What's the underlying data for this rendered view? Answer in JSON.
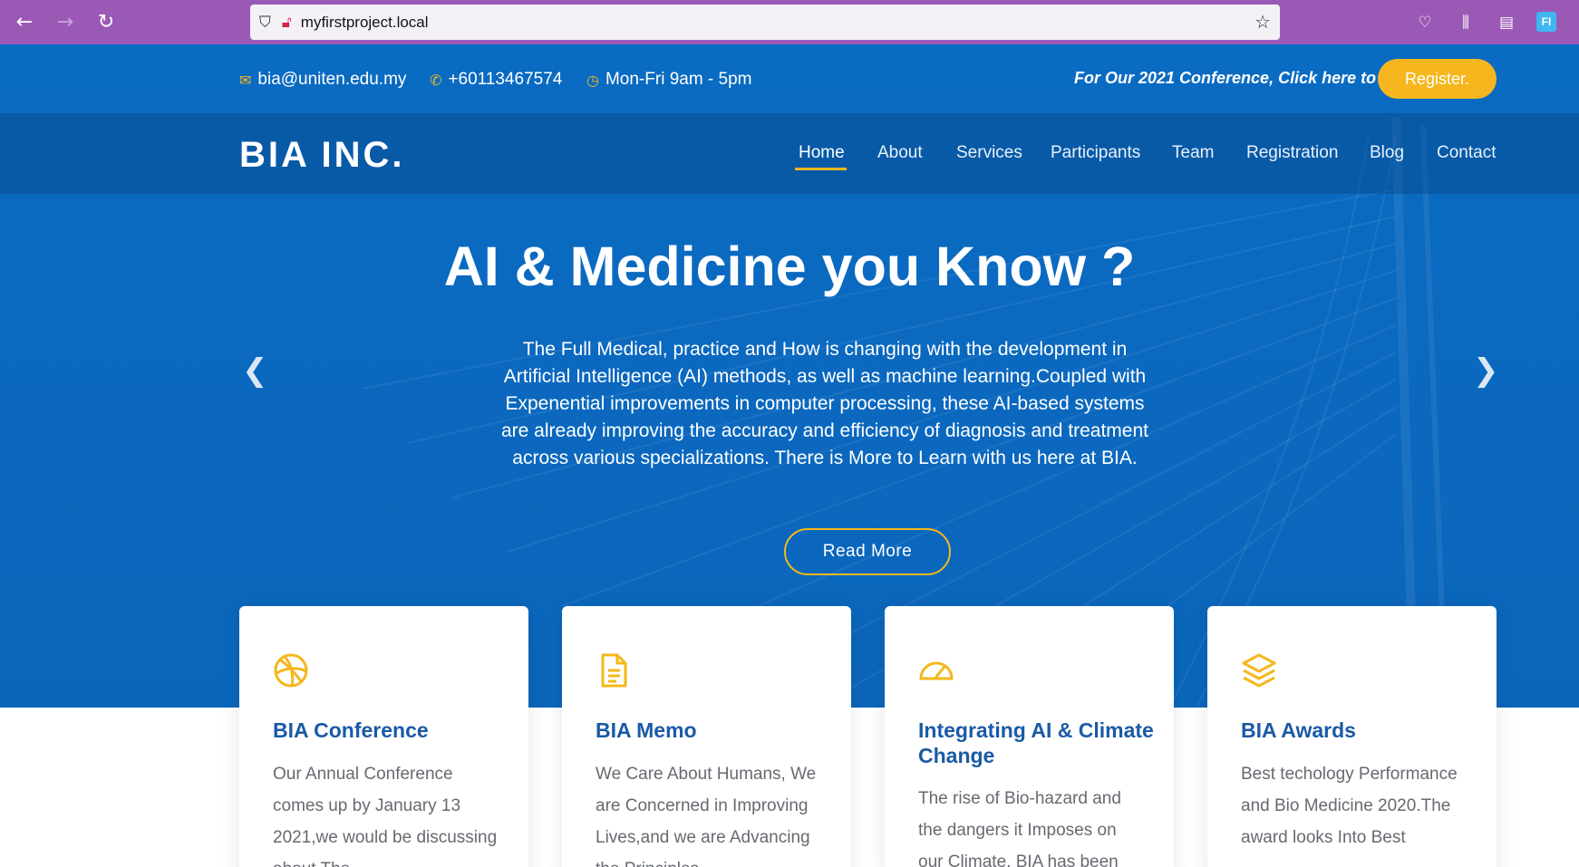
{
  "browser": {
    "url": "myfirstproject.local",
    "profile_initials": "FI"
  },
  "contact": {
    "email": "bia@uniten.edu.my",
    "phone": "+60113467574",
    "hours": "Mon-Fri 9am - 5pm"
  },
  "promo": {
    "text": "For Our 2021 Conference, Click here to",
    "register_label": "Register."
  },
  "brand": "BIA INC.",
  "nav": {
    "items": [
      {
        "label": "Home",
        "active": true
      },
      {
        "label": "About"
      },
      {
        "label": "Services"
      },
      {
        "label": "Participants"
      },
      {
        "label": "Team"
      },
      {
        "label": "Registration"
      },
      {
        "label": "Blog"
      },
      {
        "label": "Contact"
      }
    ]
  },
  "hero": {
    "title": "AI & Medicine you Know ?",
    "text": "The Full Medical, practice and How is changing with the development in Artificial Intelligence (AI) methods, as well as machine learning.Coupled with Expenential improvements in computer processing, these AI-based systems are already improving the accuracy and efficiency of diagnosis and treatment across various specializations. There is More to Learn with us here at BIA.",
    "button_label": "Read More"
  },
  "cards": [
    {
      "icon": "dribbble-icon",
      "title": "BIA Conference",
      "text": "Our Annual Conference comes up by January 13 2021,we would be discussing about The"
    },
    {
      "icon": "document-icon",
      "title": "BIA Memo",
      "text": "We Care About Humans, We are Concerned in Improving Lives,and we are Advancing the Principles"
    },
    {
      "icon": "speedometer-icon",
      "title": "Integrating AI & Climate Change",
      "text": "The rise of Bio-hazard and the dangers it Imposes on our Climate, BIA has been"
    },
    {
      "icon": "layers-icon",
      "title": "BIA Awards",
      "text": "Best techology Performance and Bio Medicine 2020.The award looks Into Best"
    }
  ],
  "colors": {
    "accent": "#f5b71d",
    "primary": "#0b68be",
    "card_title": "#1a5aa6"
  }
}
